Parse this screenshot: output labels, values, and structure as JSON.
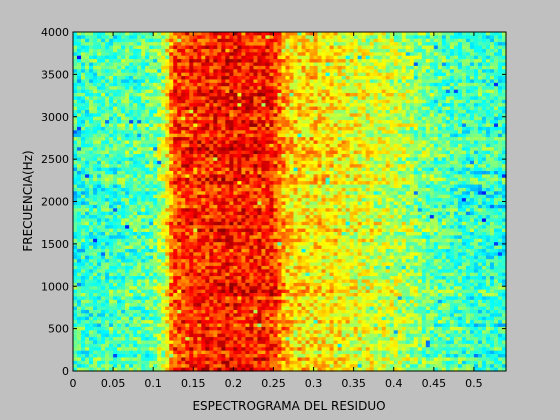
{
  "chart_data": {
    "type": "heatmap",
    "title": "",
    "xlabel": "ESPECTROGRAMA DEL RESIDUO",
    "ylabel": "FRECUENCIA(Hz)",
    "xlim": [
      0,
      0.54
    ],
    "ylim": [
      0,
      4000
    ],
    "x_ticks": [
      0,
      0.05,
      0.1,
      0.15,
      0.2,
      0.25,
      0.3,
      0.35,
      0.4,
      0.45,
      0.5
    ],
    "x_tick_labels": [
      "0",
      "0.05",
      "0.1",
      "0.15",
      "0.2",
      "0.25",
      "0.3",
      "0.35",
      "0.4",
      "0.45",
      "0.5"
    ],
    "y_ticks": [
      0,
      500,
      1000,
      1500,
      2000,
      2500,
      3000,
      3500,
      4000
    ],
    "y_tick_labels": [
      "0",
      "500",
      "1000",
      "1500",
      "2000",
      "2500",
      "3000",
      "3500",
      "4000"
    ],
    "colormap": "jet",
    "colormap_colors": [
      "#00008f",
      "#0000ff",
      "#00ffff",
      "#ffff00",
      "#ff0000",
      "#800000"
    ],
    "grid": false,
    "energy_profile": {
      "description_units": "relative intensity 0-1 vs time (s)",
      "time": [
        0,
        0.05,
        0.1,
        0.115,
        0.125,
        0.15,
        0.2,
        0.25,
        0.26,
        0.27,
        0.3,
        0.33,
        0.35,
        0.4,
        0.42,
        0.45,
        0.5,
        0.54
      ],
      "level": [
        0.42,
        0.45,
        0.47,
        0.58,
        0.8,
        0.84,
        0.86,
        0.84,
        0.73,
        0.66,
        0.65,
        0.63,
        0.6,
        0.57,
        0.53,
        0.47,
        0.43,
        0.42
      ]
    }
  }
}
